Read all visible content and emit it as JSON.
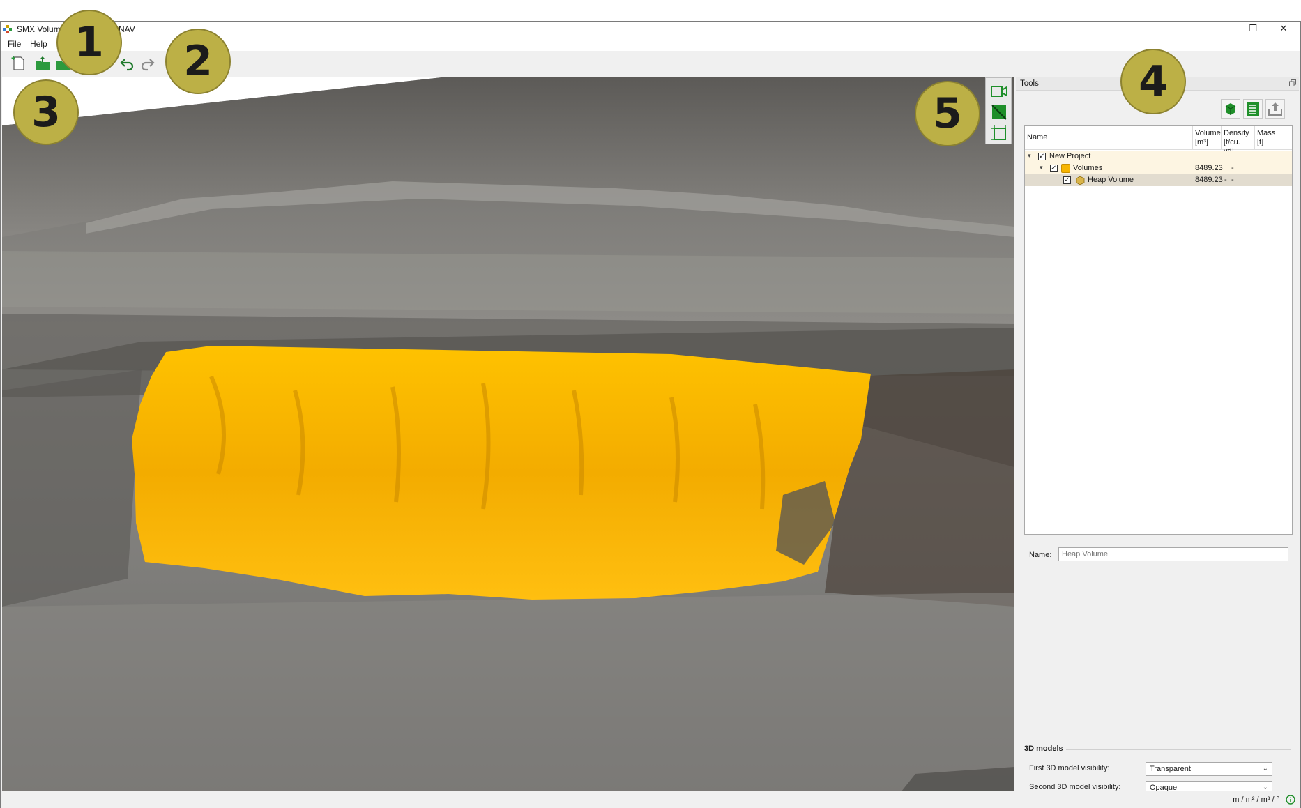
{
  "window": {
    "title": "SMX Volume",
    "title_tail": "NAV",
    "controls": {
      "minimize": "—",
      "restore": "❐",
      "close": "✕"
    }
  },
  "menu": {
    "file": "File",
    "help": "Help"
  },
  "toolbar": {
    "icons": [
      "new-project-icon",
      "open-icon",
      "save-icon",
      "undo-icon",
      "redo-icon"
    ]
  },
  "tools": {
    "title": "Tools",
    "columns": {
      "name": "Name",
      "volume": "Volume",
      "volume_unit": "[m³]",
      "density": "Density",
      "density_unit": "[t/cu. yd]",
      "mass": "Mass",
      "mass_unit": "[t]"
    },
    "rows": [
      {
        "name": "New Project",
        "checked": true,
        "volume": "",
        "density": "",
        "mass": ""
      },
      {
        "name": "Volumes",
        "checked": true,
        "volume": "8489.23",
        "density": "",
        "mass": "-"
      },
      {
        "name": "Heap Volume",
        "checked": true,
        "volume": "8489.23",
        "density": "-",
        "mass": "-"
      }
    ],
    "name_label": "Name:",
    "name_placeholder": "Heap Volume",
    "models_title": "3D models",
    "first_label": "First 3D model visibility:",
    "first_value": "Transparent",
    "second_label": "Second 3D model visibility:",
    "second_value": "Opaque"
  },
  "status": {
    "units": "m / m² / m³ / °"
  },
  "callouts": [
    "1",
    "2",
    "3",
    "4",
    "5"
  ],
  "colors": {
    "heap": "#f7b500",
    "accent_green": "#1f8f2a"
  }
}
